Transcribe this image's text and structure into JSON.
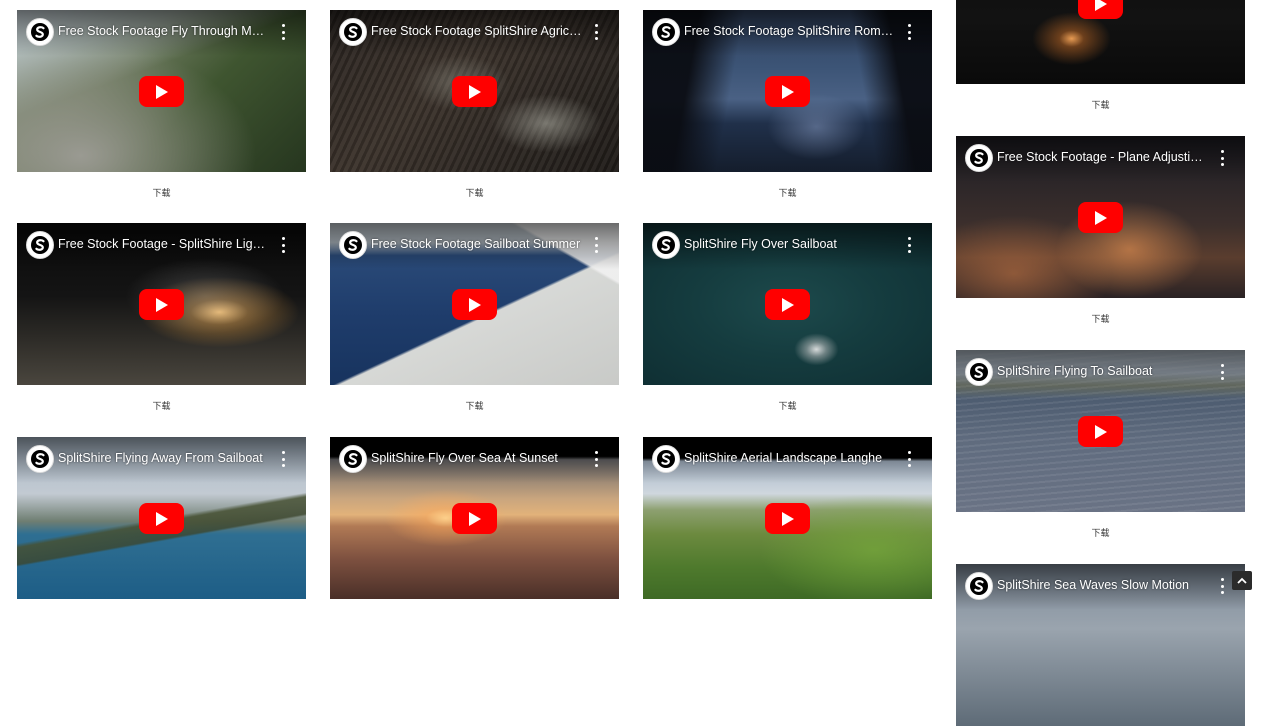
{
  "download_label": "下载",
  "videos": [
    {
      "title": "Free Stock Footage Fly Through Mountains",
      "display": "Free Stock Footage Fly Through Mou..."
    },
    {
      "title": "Free Stock Footage SplitShire Agriculture",
      "display": "Free Stock Footage SplitShire Agricul..."
    },
    {
      "title": "Free Stock Footage SplitShire Romantic",
      "display": "Free Stock Footage SplitShire Roman..."
    },
    {
      "title": "Free Stock Footage - SplitShire Light Bulb",
      "display": "Free Stock Footage - SplitShire Light ..."
    },
    {
      "title": "Free Stock Footage Sailboat Summer",
      "display": "Free Stock Footage Sailboat Summer"
    },
    {
      "title": "SplitShire Fly Over Sailboat",
      "display": "SplitShire Fly Over Sailboat"
    },
    {
      "title": "SplitShire Flying Away From Sailboat",
      "display": "SplitShire Flying Away From Sailboat"
    },
    {
      "title": "SplitShire Fly Over Sea At Sunset",
      "display": "SplitShire Fly Over Sea At Sunset"
    },
    {
      "title": "SplitShire Aerial Landscape Langhe",
      "display": "SplitShire Aerial Landscape Langhe"
    },
    {
      "title": "",
      "display": ""
    },
    {
      "title": "Free Stock Footage - Plane Adjusting",
      "display": "Free Stock Footage - Plane Adjusting ..."
    },
    {
      "title": "SplitShire Flying To Sailboat",
      "display": "SplitShire Flying To Sailboat"
    },
    {
      "title": "SplitShire Sea Waves Slow Motion",
      "display": "SplitShire Sea Waves Slow Motion"
    }
  ],
  "icons": {
    "channel_logo": "splitshire-logo-icon",
    "menu": "more-vertical-icon",
    "play": "youtube-play-icon",
    "scroll_top": "chevron-up-icon"
  },
  "colors": {
    "play_button": "#ff0000",
    "background": "#ffffff"
  }
}
